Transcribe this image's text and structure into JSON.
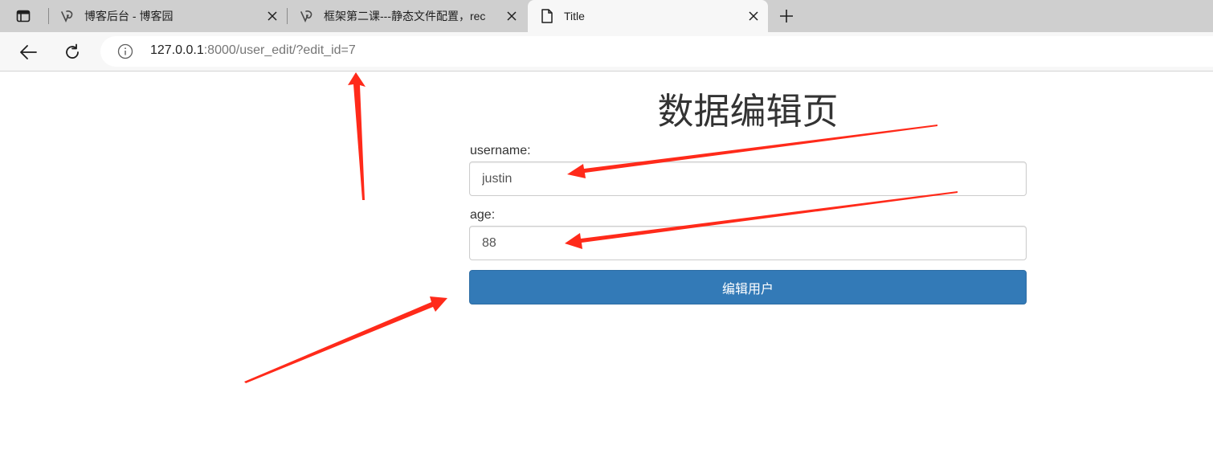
{
  "browser": {
    "tabs": [
      {
        "title": "博客后台 - 博客园",
        "icon": "cnblogs-icon",
        "active": false
      },
      {
        "title": "框架第二课---静态文件配置，rec",
        "icon": "cnblogs-icon",
        "active": false
      },
      {
        "title": "Title",
        "icon": "page-icon",
        "active": true
      }
    ],
    "address_host": "127.0.0.1",
    "address_rest": ":8000/user_edit/?edit_id=7"
  },
  "page": {
    "title": "数据编辑页",
    "username_label": "username:",
    "username_value": "justin",
    "age_label": "age:",
    "age_value": "88",
    "submit_label": "编辑用户"
  },
  "colors": {
    "button": "#337ab7",
    "annotation_arrow": "#ff2a1a"
  }
}
